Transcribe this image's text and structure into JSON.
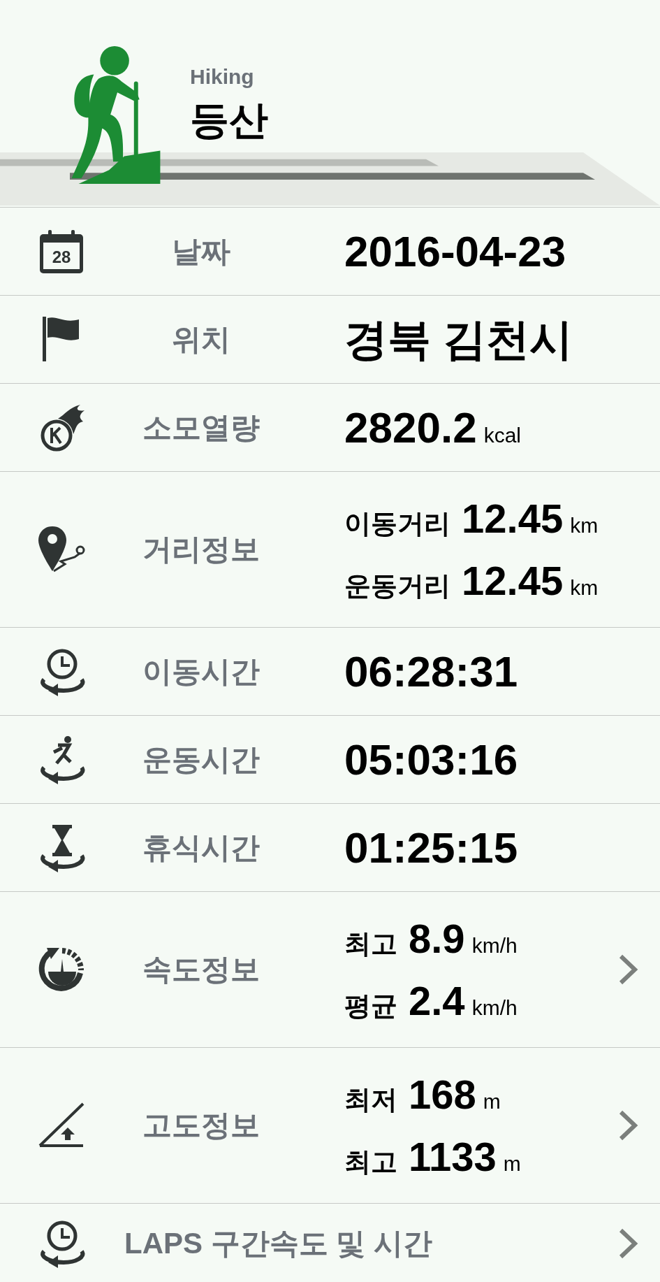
{
  "header": {
    "subtitle": "Hiking",
    "title": "등산"
  },
  "rows": [
    {
      "kind": "single",
      "icon_text": "28",
      "label": "날짜",
      "value": "2016-04-23",
      "arrow": false
    },
    {
      "kind": "single",
      "label": "위치",
      "value": "경북 김천시",
      "arrow": false
    },
    {
      "kind": "single",
      "label": "소모열량",
      "value": "2820.2",
      "unit": "kcal",
      "arrow": false
    },
    {
      "kind": "pair",
      "label": "거리정보",
      "lines": [
        {
          "label": "이동거리",
          "value": "12.45",
          "unit": "km"
        },
        {
          "label": "운동거리",
          "value": "12.45",
          "unit": "km"
        }
      ],
      "arrow": false
    },
    {
      "kind": "single",
      "label": "이동시간",
      "value": "06:28:31",
      "arrow": false
    },
    {
      "kind": "single",
      "label": "운동시간",
      "value": "05:03:16",
      "arrow": false
    },
    {
      "kind": "single",
      "label": "휴식시간",
      "value": "01:25:15",
      "arrow": false
    },
    {
      "kind": "pair",
      "label": "속도정보",
      "lines": [
        {
          "label": "최고",
          "value": "8.9",
          "unit": "km/h"
        },
        {
          "label": "평균",
          "value": "2.4",
          "unit": "km/h"
        }
      ],
      "arrow": true
    },
    {
      "kind": "pair",
      "label": "고도정보",
      "lines": [
        {
          "label": "최저",
          "value": "168",
          "unit": "m"
        },
        {
          "label": "최고",
          "value": "1133",
          "unit": "m"
        }
      ],
      "arrow": true
    },
    {
      "kind": "link",
      "label": "LAPS 구간속도 및 시간",
      "arrow": true
    }
  ]
}
